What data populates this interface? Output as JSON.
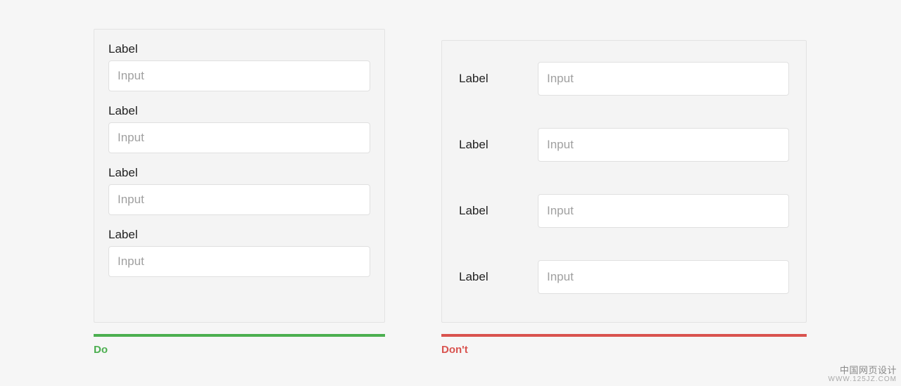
{
  "do": {
    "caption": "Do",
    "color": "#4caf50",
    "fields": [
      {
        "label": "Label",
        "placeholder": "Input"
      },
      {
        "label": "Label",
        "placeholder": "Input"
      },
      {
        "label": "Label",
        "placeholder": "Input"
      },
      {
        "label": "Label",
        "placeholder": "Input"
      }
    ]
  },
  "dont": {
    "caption": "Don't",
    "color": "#d9534f",
    "fields": [
      {
        "label": "Label",
        "placeholder": "Input"
      },
      {
        "label": "Label",
        "placeholder": "Input"
      },
      {
        "label": "Label",
        "placeholder": "Input"
      },
      {
        "label": "Label",
        "placeholder": "Input"
      }
    ]
  },
  "watermark": {
    "line1": "中国网页设计",
    "line2": "WWW.125JZ.COM"
  }
}
